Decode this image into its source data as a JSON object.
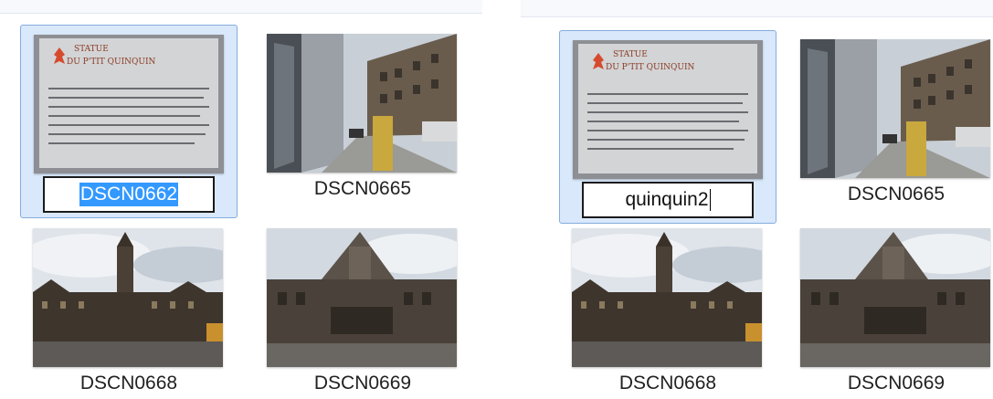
{
  "panels": [
    {
      "items": [
        {
          "name": "DSCN0662",
          "editing": true
        },
        {
          "name": "DSCN0665"
        },
        {
          "name": "DSCN0668"
        },
        {
          "name": "DSCN0669"
        }
      ],
      "thumb_text": {
        "title_line1": "STATUE",
        "title_line2": "DU P'TIT QUINQUIN"
      }
    },
    {
      "items": [
        {
          "name": "quinquin2",
          "editing": true
        },
        {
          "name": "DSCN0665"
        },
        {
          "name": "DSCN0668"
        },
        {
          "name": "DSCN0669"
        }
      ],
      "thumb_text": {
        "title_line1": "STATUE",
        "title_line2": "DU P'TIT QUINQUIN"
      }
    }
  ],
  "colors": {
    "selection_bg": "#d9e8fb",
    "selection_border": "#84acdd",
    "text_highlight": "#3399ff"
  }
}
